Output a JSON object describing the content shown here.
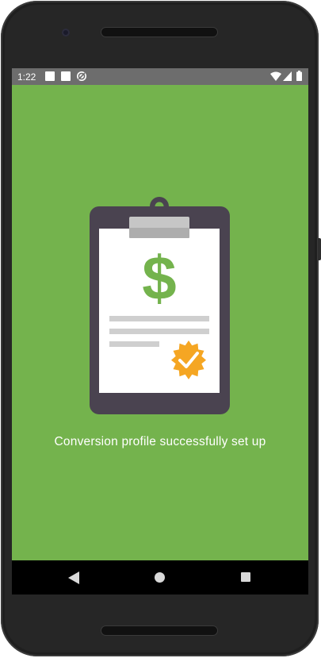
{
  "status_bar": {
    "time": "1:22",
    "icons": [
      "notification-square-icon",
      "notification-square-icon",
      "sync-icon",
      "wifi-icon",
      "signal-icon",
      "battery-icon"
    ]
  },
  "illustration": {
    "name": "clipboard-with-dollar-and-verified-badge",
    "symbol": "$",
    "colors": {
      "background": "#74b34d",
      "clipboard": "#4a4350",
      "paper": "#ffffff",
      "clip": "#b7b7b7",
      "dollar": "#74b34d",
      "lines": "#cfcfcf",
      "badge": "#f5a623"
    }
  },
  "message": {
    "text": "Conversion profile successfully set up"
  },
  "nav_bar": {
    "buttons": [
      "back-icon",
      "home-icon",
      "recents-icon"
    ]
  }
}
